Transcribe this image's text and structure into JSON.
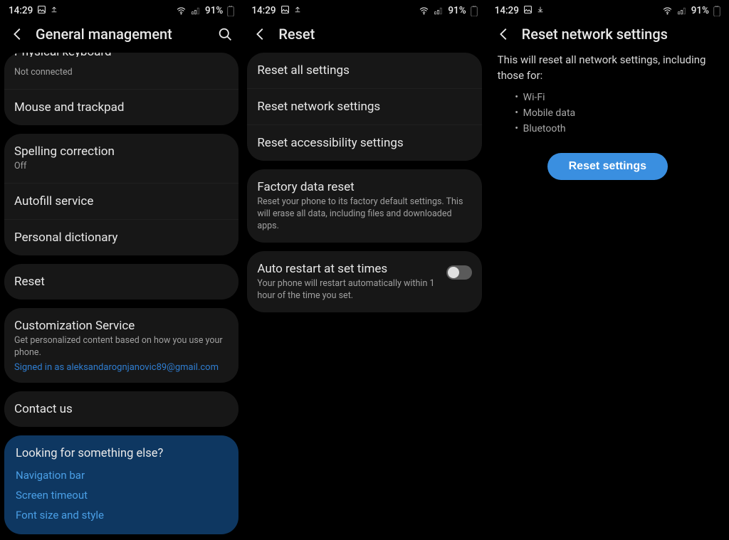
{
  "status": {
    "time": "14:29",
    "battery": "91%"
  },
  "screen1": {
    "title": "General management",
    "physical_keyboard": {
      "title": "Physical keyboard",
      "sub": "Not connected"
    },
    "mouse": "Mouse and trackpad",
    "spelling": {
      "title": "Spelling correction",
      "sub": "Off"
    },
    "autofill": "Autofill service",
    "dictionary": "Personal dictionary",
    "reset": "Reset",
    "custom": {
      "title": "Customization Service",
      "sub": "Get personalized content based on how you use your phone.",
      "signed": "Signed in as aleksandarognjanovic89@gmail.com"
    },
    "contact": "Contact us",
    "looking": {
      "title": "Looking for something else?",
      "items": [
        "Navigation bar",
        "Screen timeout",
        "Font size and style"
      ]
    }
  },
  "screen2": {
    "title": "Reset",
    "reset_all": "Reset all settings",
    "reset_network": "Reset network settings",
    "reset_access": "Reset accessibility settings",
    "factory": {
      "title": "Factory data reset",
      "sub": "Reset your phone to its factory default settings. This will erase all data, including files and downloaded apps."
    },
    "auto_restart": {
      "title": "Auto restart at set times",
      "sub": "Your phone will restart automatically within 1 hour of the time you set."
    }
  },
  "screen3": {
    "title": "Reset network settings",
    "desc": "This will reset all network settings, including those for:",
    "bullets": [
      "Wi-Fi",
      "Mobile data",
      "Bluetooth"
    ],
    "button": "Reset settings"
  }
}
